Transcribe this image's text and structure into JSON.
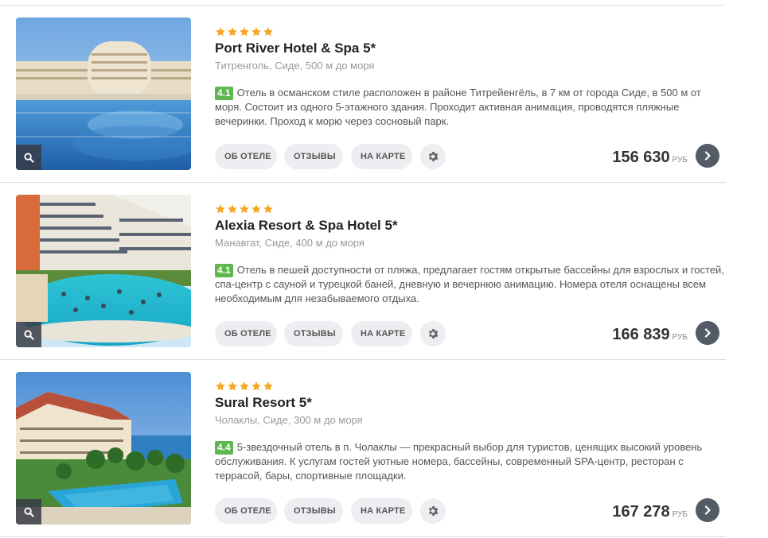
{
  "colors": {
    "star": "#f5a623",
    "rating_badge": "#5cb84d",
    "button_bg": "#eceef1",
    "go_button": "#525b66"
  },
  "hotels": [
    {
      "stars": 5,
      "name": "Port River Hotel & Spa 5*",
      "location": "Титренголь, Сиде, 500 м до моря",
      "rating": "4.1",
      "description": "Отель в османском стиле расположен в районе Титрейенгёль, в 7 км от города Сиде, в 500 м от моря. Состоит из одного 5-этажного здания. Проходит активная анимация, проводятся пляжные вечеринки. Проход к морю через сосновый парк.",
      "buttons": {
        "about": "ОБ ОТЕЛЕ",
        "reviews": "ОТЗЫВЫ",
        "map": "НА КАРТЕ"
      },
      "price": "156 630",
      "currency": "РУБ"
    },
    {
      "stars": 5,
      "name": "Alexia Resort & Spa Hotel 5*",
      "location": "Манавгат, Сиде, 400 м до моря",
      "rating": "4.1",
      "description": "Отель в пешей доступности от пляжа, предлагает гостям открытые бассейны для взрослых и гостей, спа-центр с сауной и турецкой баней, дневную и вечернюю анимацию. Номера отеля оснащены всем необходимым для незабываемого отдыха.",
      "buttons": {
        "about": "ОБ ОТЕЛЕ",
        "reviews": "ОТЗЫВЫ",
        "map": "НА КАРТЕ"
      },
      "price": "166 839",
      "currency": "РУБ"
    },
    {
      "stars": 5,
      "name": "Sural Resort 5*",
      "location": "Чолаклы, Сиде, 300 м до моря",
      "rating": "4.4",
      "description": "5-звездочный отель в п. Чолаклы — прекрасный выбор для туристов, ценящих высокий уровень обслуживания. К услугам гостей уютные номера, бассейны, современный SPA-центр, ресторан с террасой, бары, спортивные площадки.",
      "buttons": {
        "about": "ОБ ОТЕЛЕ",
        "reviews": "ОТЗЫВЫ",
        "map": "НА КАРТЕ"
      },
      "price": "167 278",
      "currency": "РУБ"
    }
  ]
}
